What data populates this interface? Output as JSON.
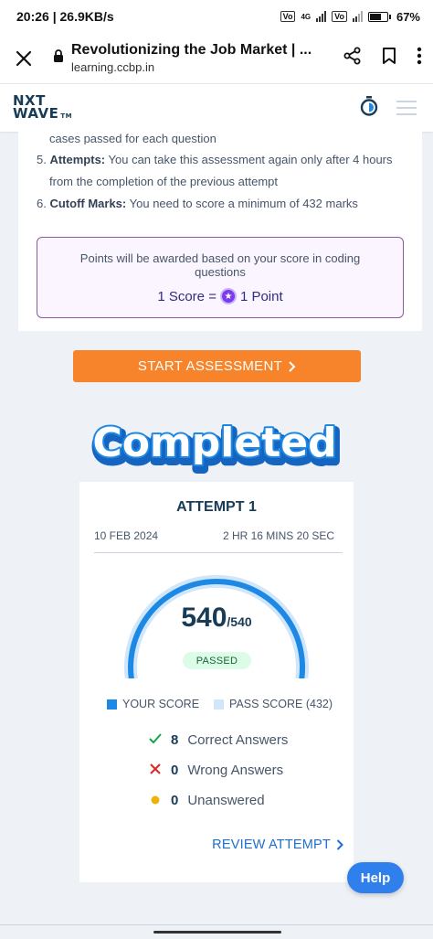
{
  "status_bar": {
    "time_speed": "20:26 | 26.9KB/s",
    "sim1_label": "Vo",
    "sim2_label": "4G",
    "battery_percent": "67%"
  },
  "browser": {
    "page_title": "Revolutionizing the Job Market | ...",
    "domain": "learning.ccbp.in",
    "icons": [
      "close-icon",
      "lock-icon",
      "share-icon",
      "bookmark-icon",
      "more-vert-icon"
    ]
  },
  "app_header": {
    "logo_line1": "NXT",
    "logo_line2": "WAVE",
    "logo_tm": "TM",
    "icons": [
      "timer-icon",
      "hamburger-menu-icon"
    ]
  },
  "instructions": {
    "cut_text": "cases passed for each question",
    "items": [
      {
        "num": "5.",
        "label": "Attempts:",
        "text_a": "You can take this assessment again only after 4 hours",
        "text_b": "from the completion of the previous attempt"
      },
      {
        "num": "6.",
        "label": "Cutoff Marks:",
        "text_a": "You need to score a minimum of 432 marks"
      }
    ],
    "points_line1": "Points will be awarded based on your score in coding",
    "points_line2": "questions",
    "points_score": "1 Score =",
    "points_point": "1 Point"
  },
  "start_button": {
    "label": "START ASSESSMENT",
    "icon": "chevron-right-icon"
  },
  "completed_banner": "Completed",
  "result": {
    "attempt_title": "ATTEMPT 1",
    "date": "10 FEB 2024",
    "duration": "2 HR 16 MINS 20 SEC",
    "score": "540",
    "score_total": "/540",
    "score_fraction": 1.0,
    "pass_fraction": 0.8,
    "status": "PASSED",
    "legend_your": "YOUR SCORE",
    "legend_pass": "PASS SCORE (432)",
    "colors": {
      "your_score": "#1e88e5",
      "pass_score": "#cfe6fb",
      "passed_bg": "#dcfce7"
    },
    "stats": [
      {
        "count": "8",
        "label": "Correct Answers",
        "icon": "check-icon",
        "color": "#16a34a"
      },
      {
        "count": "0",
        "label": "Wrong Answers",
        "icon": "cross-icon",
        "color": "#dc2626"
      },
      {
        "count": "0",
        "label": "Unanswered",
        "icon": "dot-icon",
        "color": "#eab308"
      }
    ],
    "review_label": "REVIEW ATTEMPT"
  },
  "help_button": "Help"
}
